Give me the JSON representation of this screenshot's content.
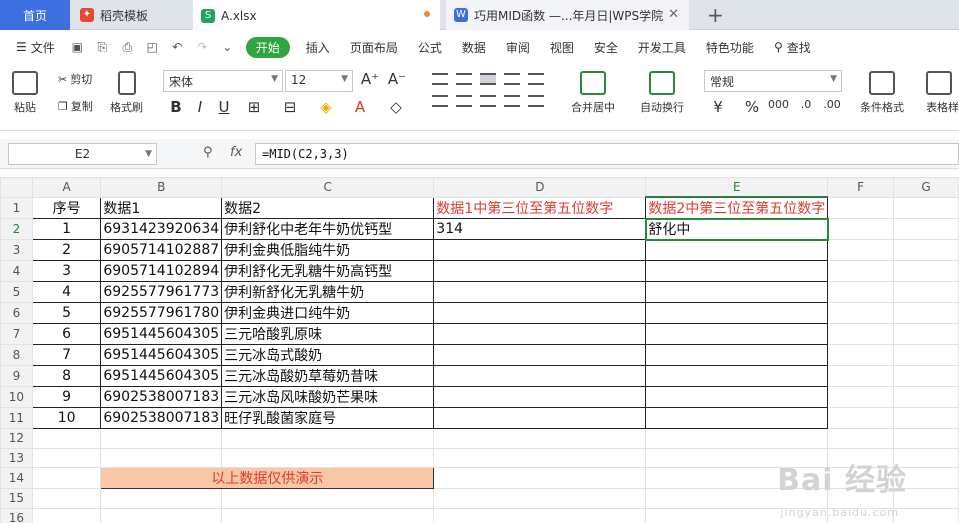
{
  "tabs": {
    "home": "首页",
    "template": "稻壳模板",
    "file": "A.xlsx",
    "web": "巧用MID函数 —...年月日|WPS学院"
  },
  "menu": {
    "file": "文件",
    "items": [
      "开始",
      "插入",
      "页面布局",
      "公式",
      "数据",
      "审阅",
      "视图",
      "安全",
      "开发工具",
      "特色功能"
    ],
    "search": "查找"
  },
  "ribbon": {
    "paste": "粘贴",
    "cut": "剪切",
    "copy": "复制",
    "format_painter": "格式刷",
    "font_name": "宋体",
    "font_size": "12",
    "merge": "合并居中",
    "wrap": "自动换行",
    "number_format": "常规",
    "cond_format": "条件格式",
    "table_style": "表格样"
  },
  "formula": {
    "cell": "E2",
    "fx": "fx",
    "content": "=MID(C2,3,3)"
  },
  "columns": [
    "A",
    "B",
    "C",
    "D",
    "E",
    "F",
    "G"
  ],
  "headers": {
    "a": "序号",
    "b": "数据1",
    "c": "数据2",
    "d": "数据1中第三位至第五位数字",
    "e": "数据2中第三位至第五位数字"
  },
  "rows": [
    {
      "n": "1",
      "b": "6931423920634",
      "c": "伊利舒化中老年牛奶优钙型",
      "d": "314",
      "e": "舒化中"
    },
    {
      "n": "2",
      "b": "6905714102887",
      "c": "伊利金典低脂纯牛奶",
      "d": "",
      "e": ""
    },
    {
      "n": "3",
      "b": "6905714102894",
      "c": "伊利舒化无乳糖牛奶高钙型",
      "d": "",
      "e": ""
    },
    {
      "n": "4",
      "b": "6925577961773",
      "c": "伊利新舒化无乳糖牛奶",
      "d": "",
      "e": ""
    },
    {
      "n": "5",
      "b": "6925577961780",
      "c": "伊利金典进口纯牛奶",
      "d": "",
      "e": ""
    },
    {
      "n": "6",
      "b": "6951445604305",
      "c": "三元哈酸乳原味",
      "d": "",
      "e": ""
    },
    {
      "n": "7",
      "b": "6951445604305",
      "c": "三元冰岛式酸奶",
      "d": "",
      "e": ""
    },
    {
      "n": "8",
      "b": "6951445604305",
      "c": "三元冰岛酸奶草莓奶昔味",
      "d": "",
      "e": ""
    },
    {
      "n": "9",
      "b": "6902538007183",
      "c": "三元冰岛风味酸奶芒果味",
      "d": "",
      "e": ""
    },
    {
      "n": "10",
      "b": "6902538007183",
      "c": "旺仔乳酸菌家庭号",
      "d": "",
      "e": ""
    }
  ],
  "note": "以上数据仅供演示",
  "watermark": {
    "main": "Bai 经验",
    "sub": "jingyan.baidu.com"
  }
}
